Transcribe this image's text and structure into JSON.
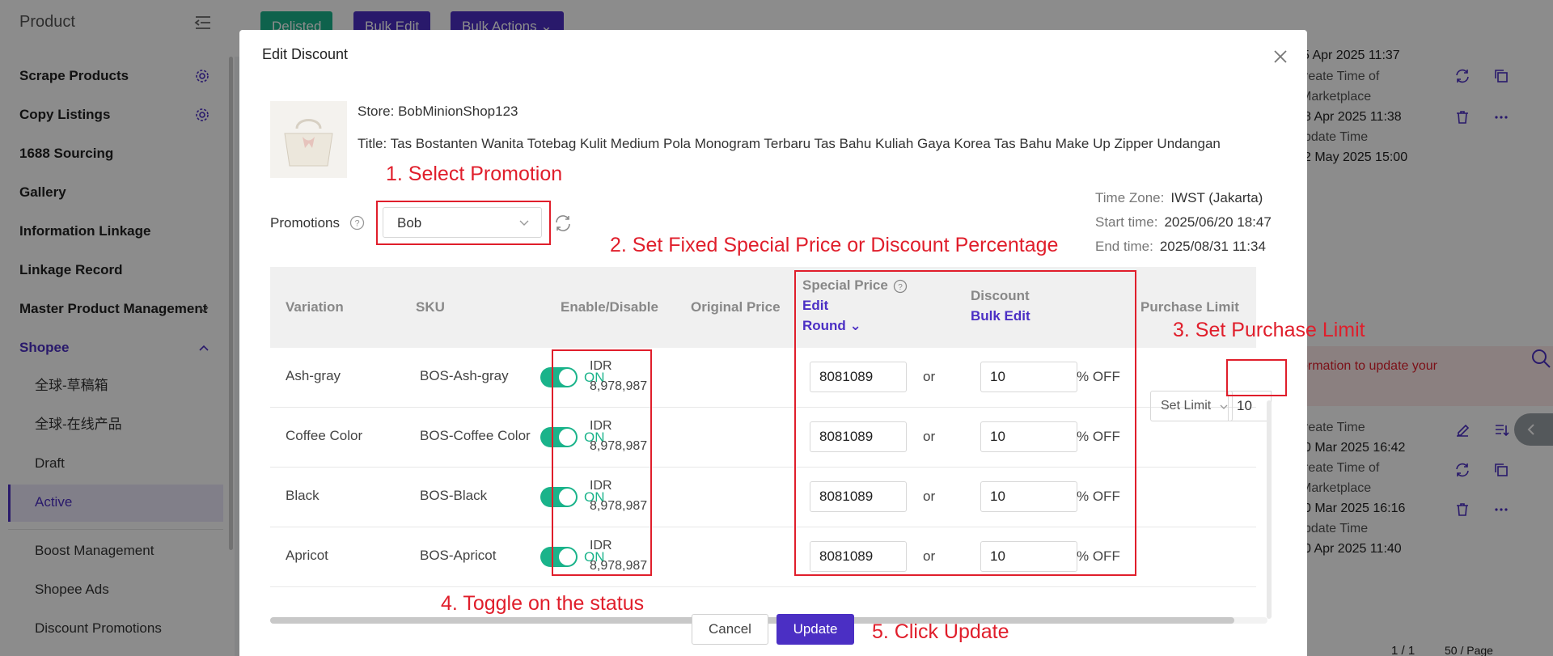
{
  "sidebar": {
    "header": "Product",
    "items": [
      {
        "label": "Scrape Products"
      },
      {
        "label": "Copy Listings"
      },
      {
        "label": "1688 Sourcing"
      },
      {
        "label": "Gallery"
      },
      {
        "label": "Information Linkage"
      },
      {
        "label": "Linkage Record"
      },
      {
        "label": "Master Product Management"
      },
      {
        "label": "Shopee"
      }
    ],
    "sub_items": [
      {
        "label": "全球-草稿箱"
      },
      {
        "label": "全球-在线产品"
      },
      {
        "label": "Draft"
      },
      {
        "label": "Active"
      },
      {
        "label": "Boost Management"
      },
      {
        "label": "Shopee Ads"
      },
      {
        "label": "Discount Promotions"
      }
    ]
  },
  "toolbar": {
    "delisted": "Delisted",
    "bulk_edit": "Bulk Edit",
    "bulk_actions": "Bulk Actions"
  },
  "background_panel": {
    "rows": [
      {
        "create_label_a": "reate Time of",
        "create_label_b": "Marketplace",
        "create_time": "8 Apr 2025 11:38",
        "update_label": "pdate Time",
        "update_time": "2 May 2025 15:00"
      },
      {
        "create_label": "reate Time",
        "create_time": "0 Mar 2025 16:42",
        "market_label_a": "reate Time of",
        "market_label_b": "Marketplace",
        "market_time": "0 Mar 2025 16:16",
        "update_label": "pdate Time",
        "update_time": "0 Apr 2025 11:40"
      }
    ],
    "top_time": "5 Apr 2025 11:37",
    "notice": "ormation to update your",
    "pager": "1 / 1",
    "page_size": "50 / Page"
  },
  "modal": {
    "title": "Edit Discount",
    "store": "Store: BobMinionShop123",
    "product_title": "Title: Tas Bostanten Wanita Totebag Kulit Medium Pola Monogram Terbaru Tas Bahu Kuliah Gaya Korea Tas Bahu Make Up Zipper Undangan",
    "promotions_label": "Promotions",
    "promotion_selected": "Bob",
    "timezone_label": "Time Zone:",
    "timezone_value": "IWST (Jakarta)",
    "start_label": "Start time:",
    "start_value": "2025/06/20 18:47",
    "end_label": "End time:",
    "end_value": "2025/08/31 11:34",
    "columns": {
      "variation": "Variation",
      "sku": "SKU",
      "enable": "Enable/Disable",
      "original_price": "Original Price",
      "special_price": "Special Price",
      "special_edit": "Edit",
      "special_round": "Round",
      "discount": "Discount",
      "discount_bulk": "Bulk Edit",
      "purchase_limit": "Purchase Limit"
    },
    "rows": [
      {
        "variation": "Ash-gray",
        "sku": "BOS-Ash-gray",
        "status": "ON",
        "currency": "IDR",
        "price": "8,978,987",
        "special": "8081089",
        "or": "or",
        "discount": "10",
        "off": "% OFF"
      },
      {
        "variation": "Coffee Color",
        "sku": "BOS-Coffee Color",
        "status": "ON",
        "currency": "IDR",
        "price": "8,978,987",
        "special": "8081089",
        "or": "or",
        "discount": "10",
        "off": "% OFF"
      },
      {
        "variation": "Black",
        "sku": "BOS-Black",
        "status": "ON",
        "currency": "IDR",
        "price": "8,978,987",
        "special": "8081089",
        "or": "or",
        "discount": "10",
        "off": "% OFF"
      },
      {
        "variation": "Apricot",
        "sku": "BOS-Apricot",
        "status": "ON",
        "currency": "IDR",
        "price": "8,978,987",
        "special": "8081089",
        "or": "or",
        "discount": "10",
        "off": "% OFF"
      }
    ],
    "set_limit": "Set Limit",
    "limit_value": "10",
    "cancel": "Cancel",
    "update": "Update"
  },
  "annotations": {
    "step1": "1. Select Promotion",
    "step2": "2. Set Fixed Special Price or Discount Percentage",
    "step3": "3. Set Purchase Limit",
    "step4": "4. Toggle on the status",
    "step5": "5. Click Update"
  },
  "colors": {
    "accent": "#4b2fc4",
    "toggle_on": "#1ab38a",
    "annotation": "#e01e2b"
  }
}
